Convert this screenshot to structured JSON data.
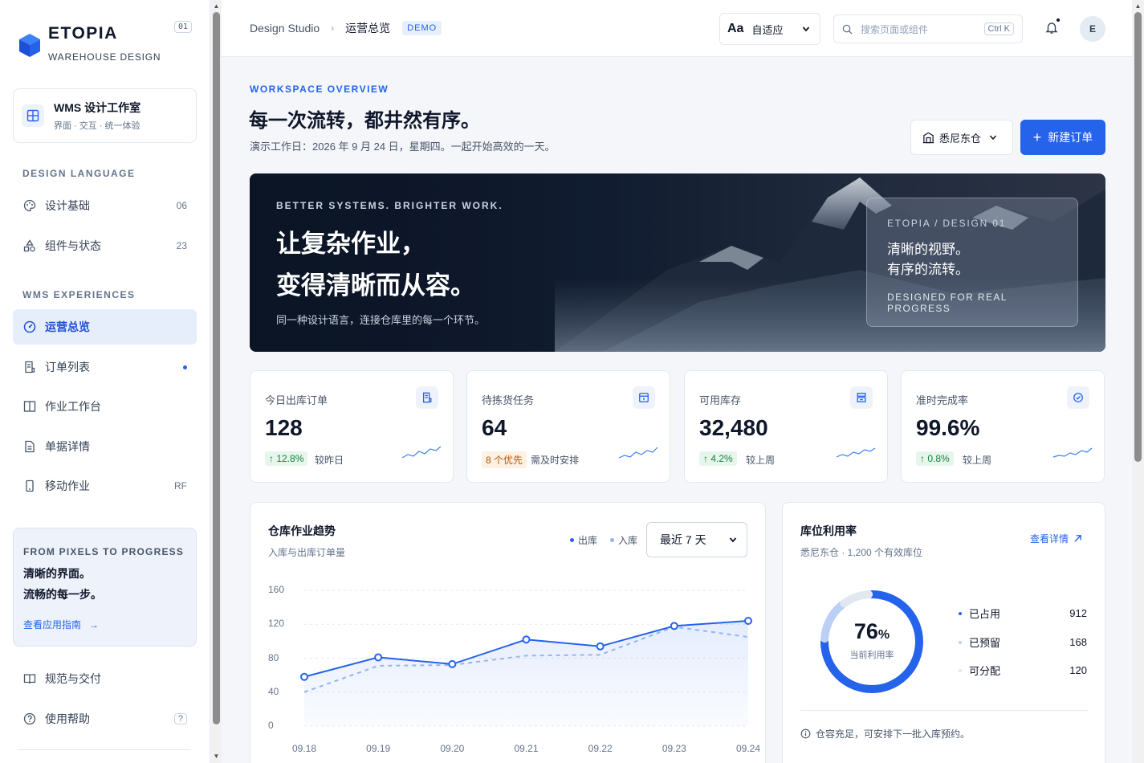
{
  "brand": {
    "name": "ETOPIA",
    "subtitle": "WAREHOUSE DESIGN",
    "version": "01"
  },
  "workspace": {
    "title": "WMS 设计工作室",
    "subtitle": "界面 · 交互 · 统一体验"
  },
  "sidebar": {
    "design_language_label": "DESIGN LANGUAGE",
    "design_items": [
      {
        "label": "设计基础",
        "count": "06",
        "icon": "palette-icon"
      },
      {
        "label": "组件与状态",
        "count": "23",
        "icon": "shapes-icon"
      }
    ],
    "wms_label": "WMS EXPERIENCES",
    "wms_items": [
      {
        "label": "运营总览",
        "icon": "gauge-icon",
        "active": true
      },
      {
        "label": "订单列表",
        "icon": "receipt-icon",
        "dot": true
      },
      {
        "label": "作业工作台",
        "icon": "columns-icon"
      },
      {
        "label": "单据详情",
        "icon": "document-icon"
      },
      {
        "label": "移动作业",
        "count": "RF",
        "icon": "mobile-icon"
      }
    ],
    "promo": {
      "kicker": "FROM PIXELS TO PROGRESS",
      "line1": "清晰的界面。",
      "line2": "流畅的每一步。",
      "link": "查看应用指南"
    },
    "footer_items": [
      {
        "label": "规范与交付",
        "icon": "book-icon"
      },
      {
        "label": "使用帮助",
        "icon": "help-icon",
        "badge": "?"
      }
    ]
  },
  "header": {
    "breadcrumb_root": "Design Studio",
    "breadcrumb_current": "运营总览",
    "badge": "DEMO",
    "font_select_prefix": "Aa",
    "font_select_value": "自适应",
    "search_placeholder": "搜索页面或组件",
    "search_shortcut": "Ctrl K",
    "avatar_initial": "E"
  },
  "overview": {
    "kicker": "WORKSPACE OVERVIEW",
    "title": "每一次流转，都井然有序。",
    "subtitle": "演示工作日：2026 年 9 月 24 日，星期四。一起开始高效的一天。",
    "warehouse": "悉尼东仓",
    "new_order": "新建订单"
  },
  "hero": {
    "kicker": "BETTER SYSTEMS. BRIGHTER WORK.",
    "title_line1": "让复杂作业，",
    "title_line2": "变得清晰而从容。",
    "subtitle": "同一种设计语言，连接仓库里的每一个环节。",
    "card_kicker": "ETOPIA / DESIGN 01",
    "card_line1": "清晰的视野。",
    "card_line2": "有序的流转。",
    "card_footer": "DESIGNED FOR REAL PROGRESS"
  },
  "kpis": [
    {
      "label": "今日出库订单",
      "value": "128",
      "badge": "↑ 12.8%",
      "badge_type": "up",
      "note": "较昨日",
      "icon": "receipt-icon"
    },
    {
      "label": "待拣货任务",
      "value": "64",
      "badge": "8 个优先",
      "badge_type": "warn",
      "note": "需及时安排",
      "icon": "box-icon"
    },
    {
      "label": "可用库存",
      "value": "32,480",
      "badge": "↑ 4.2%",
      "badge_type": "up",
      "note": "较上周",
      "icon": "stack-icon"
    },
    {
      "label": "准时完成率",
      "value": "99.6%",
      "badge": "↑ 0.8%",
      "badge_type": "up",
      "note": "较上周",
      "icon": "check-circle-icon"
    }
  ],
  "trend": {
    "title": "仓库作业趋势",
    "subtitle": "入库与出库订单量",
    "legend_out": "出库",
    "legend_in": "入库",
    "range": "最近 7 天"
  },
  "chart_data": {
    "type": "line",
    "x": [
      "09.18",
      "09.19",
      "09.20",
      "09.21",
      "09.22",
      "09.23",
      "09.24"
    ],
    "yticks": [
      "160",
      "120",
      "80",
      "40",
      "0"
    ],
    "ylim": [
      0,
      160
    ],
    "series": [
      {
        "name": "出库",
        "values": [
          58,
          81,
          73,
          102,
          94,
          118,
          124
        ],
        "color": "#2563eb",
        "style": "solid"
      },
      {
        "name": "入库",
        "values": [
          40,
          71,
          72,
          83,
          84,
          117,
          105
        ],
        "color": "#93b4ef",
        "style": "dashed"
      }
    ],
    "grid": true
  },
  "utilization": {
    "title": "库位利用率",
    "subtitle": "悉尼东仓 · 1,200 个有效库位",
    "link": "查看详情",
    "value": "76",
    "unit": "%",
    "center_label": "当前利用率",
    "rows": [
      {
        "label": "已占用",
        "value": "912",
        "color": "#2563eb"
      },
      {
        "label": "已预留",
        "value": "168",
        "color": "#bcd0f5"
      },
      {
        "label": "可分配",
        "value": "120",
        "color": "#e2e8f0"
      }
    ],
    "note": "仓容充足，可安排下一批入库预约。"
  },
  "colors": {
    "accent": "#2563eb",
    "sidebar_active": "#e6eefb"
  }
}
